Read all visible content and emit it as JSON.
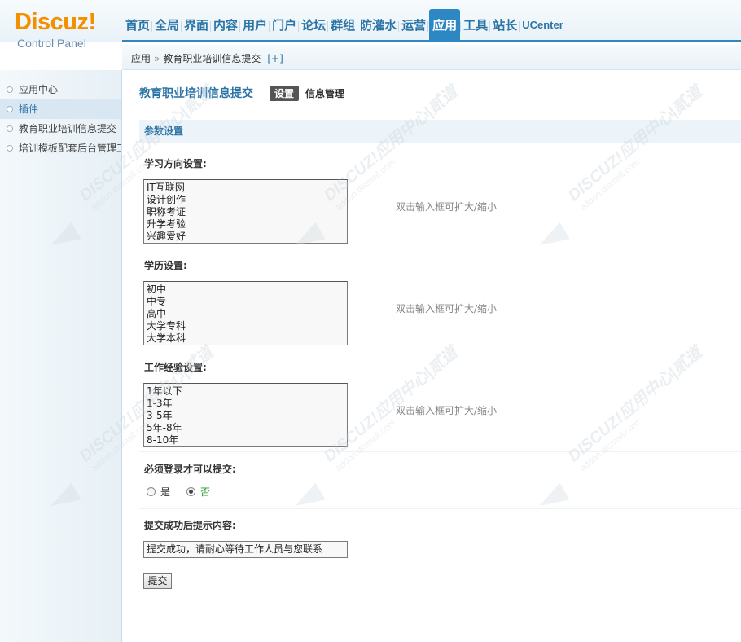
{
  "logo": {
    "brand": "Discuz!",
    "subtitle": "Control Panel"
  },
  "topnav": [
    "首页",
    "全局",
    "界面",
    "内容",
    "用户",
    "门户",
    "论坛",
    "群组",
    "防灌水",
    "运营",
    "应用",
    "工具",
    "站长",
    "UCenter"
  ],
  "topnav_active": "应用",
  "breadcrumb": {
    "root": "应用",
    "separator": "»",
    "current": "教育职业培训信息提交",
    "add": "[+]"
  },
  "sidebar": {
    "items": [
      {
        "label": "应用中心"
      },
      {
        "label": "插件"
      },
      {
        "label": "教育职业培训信息提交"
      },
      {
        "label": "培训模板配套后台管理工具"
      }
    ],
    "active": "插件"
  },
  "main": {
    "plugin_title": "教育职业培训信息提交",
    "tabs": {
      "settings": "设置",
      "manage": "信息管理"
    },
    "section_title": "参数设置",
    "fields": {
      "study_direction": {
        "label": "学习方向设置:",
        "value": "IT互联网\n设计创作\n职称考证\n升学考验\n兴趣爱好",
        "hint": "双击输入框可扩大/缩小"
      },
      "education": {
        "label": "学历设置:",
        "value": "初中\n中专\n高中\n大学专科\n大学本科",
        "hint": "双击输入框可扩大/缩小"
      },
      "experience": {
        "label": "工作经验设置:",
        "value": "1年以下\n1-3年\n3-5年\n5年-8年\n8-10年",
        "hint": "双击输入框可扩大/缩小"
      },
      "require_login": {
        "label": "必须登录才可以提交:",
        "options": {
          "yes": "是",
          "no": "否"
        },
        "selected": "否"
      },
      "success_message": {
        "label": "提交成功后提示内容:",
        "value": "提交成功，请耐心等待工作人员与您联系"
      }
    },
    "submit_label": "提交"
  },
  "watermark": {
    "text": "DISCUZ!应用中心|贰道",
    "sub": "addon.dismall.com"
  },
  "colors": {
    "accent": "#2c87c3",
    "brand": "#f29000",
    "link": "#2b74a6"
  }
}
